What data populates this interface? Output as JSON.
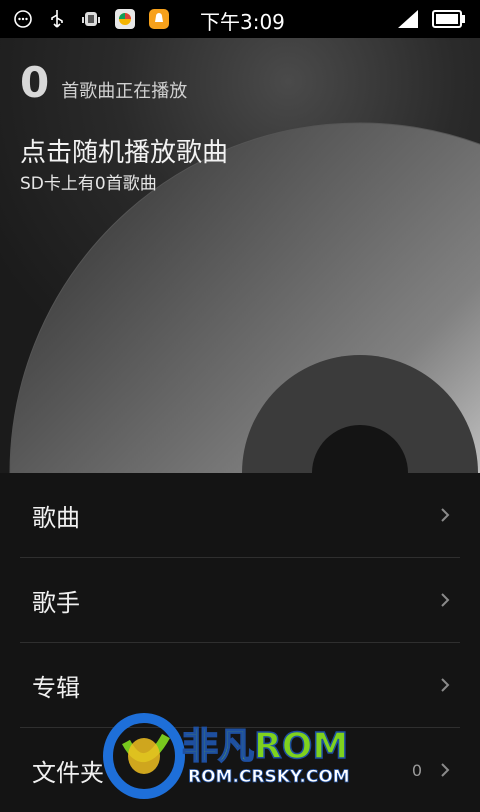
{
  "status_bar": {
    "time": "下午3:09",
    "icons": [
      "message-icon",
      "usb-icon",
      "android-debug-icon",
      "app-icon",
      "notification-icon",
      "signal-icon",
      "battery-icon"
    ]
  },
  "header": {
    "count": "0",
    "count_label": "首歌曲正在播放",
    "shuffle_label": "点击随机播放歌曲",
    "sd_info": "SD卡上有0首歌曲"
  },
  "menu": [
    {
      "label": "歌曲",
      "count": ""
    },
    {
      "label": "歌手",
      "count": ""
    },
    {
      "label": "专辑",
      "count": ""
    },
    {
      "label": "文件夹",
      "count": "0"
    }
  ],
  "watermark": {
    "brand": "非凡ROM",
    "url": "ROM.CRSKY.COM"
  },
  "colors": {
    "background": "#141414",
    "hero_dark": "#1b1b1b",
    "divider": "#2f2f2f",
    "watermark_blue": "#1e6fd9",
    "watermark_green": "#78c81e"
  }
}
